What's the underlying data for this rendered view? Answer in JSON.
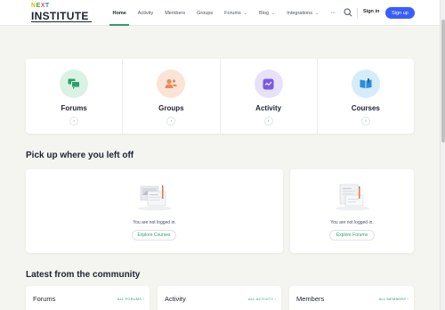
{
  "logo": {
    "top_letters": [
      "N",
      "E",
      "X",
      "T"
    ],
    "name": "INSTITUTE"
  },
  "nav": {
    "items": [
      {
        "label": "Home",
        "active": true,
        "dropdown": false
      },
      {
        "label": "Activity",
        "active": false,
        "dropdown": false
      },
      {
        "label": "Members",
        "active": false,
        "dropdown": false
      },
      {
        "label": "Groups",
        "active": false,
        "dropdown": false
      },
      {
        "label": "Forums",
        "active": false,
        "dropdown": true
      },
      {
        "label": "Blog",
        "active": false,
        "dropdown": true
      },
      {
        "label": "Integrations",
        "active": false,
        "dropdown": true
      }
    ],
    "more": "···"
  },
  "header": {
    "signin": "Sign in",
    "signup": "Sign up"
  },
  "quick_links": [
    {
      "label": "Forums",
      "icon": "forums-icon",
      "bg": "#d9f2e4",
      "fg": "#2ea06b"
    },
    {
      "label": "Groups",
      "icon": "groups-icon",
      "bg": "#fbe3d6",
      "fg": "#e98a5c"
    },
    {
      "label": "Activity",
      "icon": "activity-icon",
      "bg": "#e7e1fa",
      "fg": "#7a5ae0"
    },
    {
      "label": "Courses",
      "icon": "courses-icon",
      "bg": "#d6ecfb",
      "fg": "#2a8fd8"
    }
  ],
  "pickup": {
    "title": "Pick up where you left off",
    "left": {
      "message": "You are not logged in.",
      "button": "Explore Courses"
    },
    "right": {
      "message": "You are not logged in.",
      "button": "Explore Forums"
    }
  },
  "community": {
    "title": "Latest from the community",
    "columns": [
      {
        "title": "Forums",
        "link": "ALL FORUMS ›"
      },
      {
        "title": "Activity",
        "link": "ALL ACTIVITY ›"
      },
      {
        "title": "Members",
        "link": "ALL MEMBERS ›"
      }
    ]
  },
  "colors": {
    "accent": "#2ea06b",
    "primary": "#385dff"
  }
}
